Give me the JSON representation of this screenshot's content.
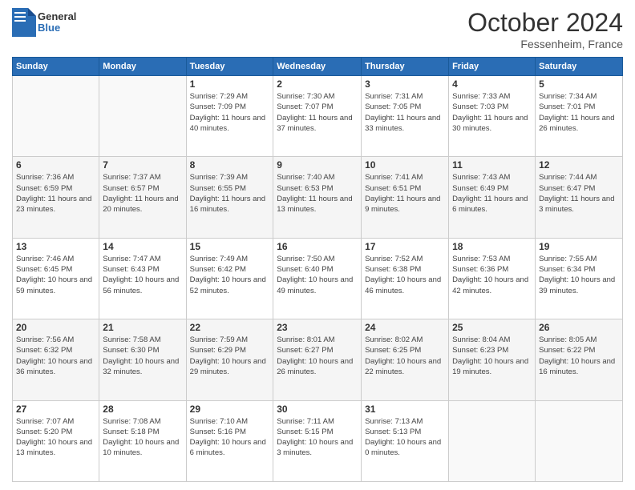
{
  "header": {
    "logo": {
      "line1": "General",
      "line2": "Blue"
    },
    "month": "October 2024",
    "location": "Fessenheim, France"
  },
  "days_of_week": [
    "Sunday",
    "Monday",
    "Tuesday",
    "Wednesday",
    "Thursday",
    "Friday",
    "Saturday"
  ],
  "weeks": [
    [
      {
        "day": "",
        "sunrise": "",
        "sunset": "",
        "daylight": ""
      },
      {
        "day": "",
        "sunrise": "",
        "sunset": "",
        "daylight": ""
      },
      {
        "day": "1",
        "sunrise": "Sunrise: 7:29 AM",
        "sunset": "Sunset: 7:09 PM",
        "daylight": "Daylight: 11 hours and 40 minutes."
      },
      {
        "day": "2",
        "sunrise": "Sunrise: 7:30 AM",
        "sunset": "Sunset: 7:07 PM",
        "daylight": "Daylight: 11 hours and 37 minutes."
      },
      {
        "day": "3",
        "sunrise": "Sunrise: 7:31 AM",
        "sunset": "Sunset: 7:05 PM",
        "daylight": "Daylight: 11 hours and 33 minutes."
      },
      {
        "day": "4",
        "sunrise": "Sunrise: 7:33 AM",
        "sunset": "Sunset: 7:03 PM",
        "daylight": "Daylight: 11 hours and 30 minutes."
      },
      {
        "day": "5",
        "sunrise": "Sunrise: 7:34 AM",
        "sunset": "Sunset: 7:01 PM",
        "daylight": "Daylight: 11 hours and 26 minutes."
      }
    ],
    [
      {
        "day": "6",
        "sunrise": "Sunrise: 7:36 AM",
        "sunset": "Sunset: 6:59 PM",
        "daylight": "Daylight: 11 hours and 23 minutes."
      },
      {
        "day": "7",
        "sunrise": "Sunrise: 7:37 AM",
        "sunset": "Sunset: 6:57 PM",
        "daylight": "Daylight: 11 hours and 20 minutes."
      },
      {
        "day": "8",
        "sunrise": "Sunrise: 7:39 AM",
        "sunset": "Sunset: 6:55 PM",
        "daylight": "Daylight: 11 hours and 16 minutes."
      },
      {
        "day": "9",
        "sunrise": "Sunrise: 7:40 AM",
        "sunset": "Sunset: 6:53 PM",
        "daylight": "Daylight: 11 hours and 13 minutes."
      },
      {
        "day": "10",
        "sunrise": "Sunrise: 7:41 AM",
        "sunset": "Sunset: 6:51 PM",
        "daylight": "Daylight: 11 hours and 9 minutes."
      },
      {
        "day": "11",
        "sunrise": "Sunrise: 7:43 AM",
        "sunset": "Sunset: 6:49 PM",
        "daylight": "Daylight: 11 hours and 6 minutes."
      },
      {
        "day": "12",
        "sunrise": "Sunrise: 7:44 AM",
        "sunset": "Sunset: 6:47 PM",
        "daylight": "Daylight: 11 hours and 3 minutes."
      }
    ],
    [
      {
        "day": "13",
        "sunrise": "Sunrise: 7:46 AM",
        "sunset": "Sunset: 6:45 PM",
        "daylight": "Daylight: 10 hours and 59 minutes."
      },
      {
        "day": "14",
        "sunrise": "Sunrise: 7:47 AM",
        "sunset": "Sunset: 6:43 PM",
        "daylight": "Daylight: 10 hours and 56 minutes."
      },
      {
        "day": "15",
        "sunrise": "Sunrise: 7:49 AM",
        "sunset": "Sunset: 6:42 PM",
        "daylight": "Daylight: 10 hours and 52 minutes."
      },
      {
        "day": "16",
        "sunrise": "Sunrise: 7:50 AM",
        "sunset": "Sunset: 6:40 PM",
        "daylight": "Daylight: 10 hours and 49 minutes."
      },
      {
        "day": "17",
        "sunrise": "Sunrise: 7:52 AM",
        "sunset": "Sunset: 6:38 PM",
        "daylight": "Daylight: 10 hours and 46 minutes."
      },
      {
        "day": "18",
        "sunrise": "Sunrise: 7:53 AM",
        "sunset": "Sunset: 6:36 PM",
        "daylight": "Daylight: 10 hours and 42 minutes."
      },
      {
        "day": "19",
        "sunrise": "Sunrise: 7:55 AM",
        "sunset": "Sunset: 6:34 PM",
        "daylight": "Daylight: 10 hours and 39 minutes."
      }
    ],
    [
      {
        "day": "20",
        "sunrise": "Sunrise: 7:56 AM",
        "sunset": "Sunset: 6:32 PM",
        "daylight": "Daylight: 10 hours and 36 minutes."
      },
      {
        "day": "21",
        "sunrise": "Sunrise: 7:58 AM",
        "sunset": "Sunset: 6:30 PM",
        "daylight": "Daylight: 10 hours and 32 minutes."
      },
      {
        "day": "22",
        "sunrise": "Sunrise: 7:59 AM",
        "sunset": "Sunset: 6:29 PM",
        "daylight": "Daylight: 10 hours and 29 minutes."
      },
      {
        "day": "23",
        "sunrise": "Sunrise: 8:01 AM",
        "sunset": "Sunset: 6:27 PM",
        "daylight": "Daylight: 10 hours and 26 minutes."
      },
      {
        "day": "24",
        "sunrise": "Sunrise: 8:02 AM",
        "sunset": "Sunset: 6:25 PM",
        "daylight": "Daylight: 10 hours and 22 minutes."
      },
      {
        "day": "25",
        "sunrise": "Sunrise: 8:04 AM",
        "sunset": "Sunset: 6:23 PM",
        "daylight": "Daylight: 10 hours and 19 minutes."
      },
      {
        "day": "26",
        "sunrise": "Sunrise: 8:05 AM",
        "sunset": "Sunset: 6:22 PM",
        "daylight": "Daylight: 10 hours and 16 minutes."
      }
    ],
    [
      {
        "day": "27",
        "sunrise": "Sunrise: 7:07 AM",
        "sunset": "Sunset: 5:20 PM",
        "daylight": "Daylight: 10 hours and 13 minutes."
      },
      {
        "day": "28",
        "sunrise": "Sunrise: 7:08 AM",
        "sunset": "Sunset: 5:18 PM",
        "daylight": "Daylight: 10 hours and 10 minutes."
      },
      {
        "day": "29",
        "sunrise": "Sunrise: 7:10 AM",
        "sunset": "Sunset: 5:16 PM",
        "daylight": "Daylight: 10 hours and 6 minutes."
      },
      {
        "day": "30",
        "sunrise": "Sunrise: 7:11 AM",
        "sunset": "Sunset: 5:15 PM",
        "daylight": "Daylight: 10 hours and 3 minutes."
      },
      {
        "day": "31",
        "sunrise": "Sunrise: 7:13 AM",
        "sunset": "Sunset: 5:13 PM",
        "daylight": "Daylight: 10 hours and 0 minutes."
      },
      {
        "day": "",
        "sunrise": "",
        "sunset": "",
        "daylight": ""
      },
      {
        "day": "",
        "sunrise": "",
        "sunset": "",
        "daylight": ""
      }
    ]
  ]
}
